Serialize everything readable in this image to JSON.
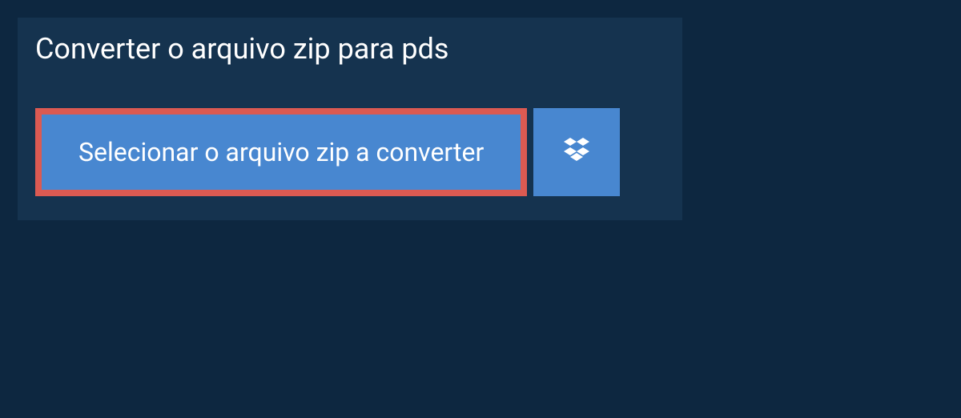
{
  "title": "Converter o arquivo zip para pds",
  "buttons": {
    "select_label": "Selecionar o arquivo zip a converter"
  },
  "icons": {
    "dropbox": "dropbox-icon"
  }
}
